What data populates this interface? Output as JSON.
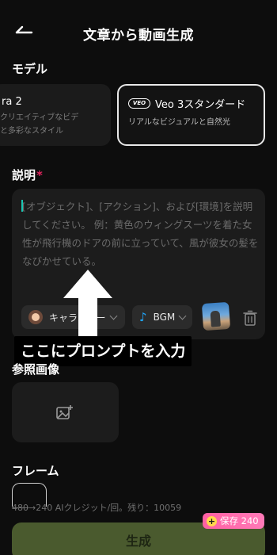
{
  "header": {
    "title": "文章から動画生成"
  },
  "model_section": {
    "label": "モデル",
    "cards": [
      {
        "name": "ra 2",
        "desc_line1": "クリエイティブなビデ",
        "desc_line2": "と多彩なスタイル",
        "selected": false
      },
      {
        "badge": "VEO",
        "name": "Veo 3スタンダード",
        "desc": "リアルなビジュアルと自然光",
        "selected": true
      }
    ]
  },
  "description": {
    "label": "説明",
    "required_mark": "*",
    "placeholder": "[オブジェクト]、[アクション]、および[環境]を説明してください。 例：黄色のウィングスーツを着た女性が飛行機のドアの前に立っていて、風が彼女の髪をなびかせている。",
    "character_chip": "キャラクター",
    "bgm_chip": "BGM"
  },
  "overlay": {
    "caption": "ここにプロンプトを入力"
  },
  "reference": {
    "label": "参照画像"
  },
  "frame": {
    "label": "フレーム"
  },
  "credits": {
    "old": "480",
    "text": "→240 AIクレジット/回。残り：10059"
  },
  "generate": {
    "label": "生成"
  },
  "save_badge": {
    "text": "保存 240"
  },
  "colors": {
    "accent_teal": "#19c6b3",
    "generate_bg": "#4a5a2e",
    "badge_pink": "#ff5fa2",
    "required_red": "#e0245e"
  }
}
